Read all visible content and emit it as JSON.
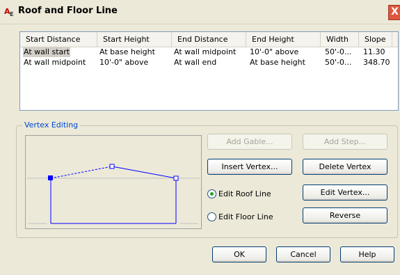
{
  "window": {
    "title": "Roof and Floor Line",
    "icon_text": "A",
    "icon_subtext": "E",
    "close_label": "X"
  },
  "columns": [
    "Start Distance",
    "Start Height",
    "End Distance",
    "End Height",
    "Width",
    "Slope"
  ],
  "rows": [
    [
      "At wall start",
      "At base height",
      "At wall midpoint",
      "10'-0\" above",
      "50'-0...",
      "11.30"
    ],
    [
      "At wall midpoint",
      "10'-0\" above",
      "At wall end",
      "At base height",
      "50'-0...",
      "348.70"
    ]
  ],
  "vertex_editing": {
    "label": "Vertex Editing",
    "buttons": {
      "add_gable": "Add Gable...",
      "add_step": "Add Step...",
      "insert_vertex": "Insert Vertex...",
      "delete_vertex": "Delete Vertex",
      "edit_vertex": "Edit Vertex...",
      "reverse": "Reverse"
    },
    "radios": {
      "edit_roof_line": "Edit Roof Line",
      "edit_floor_line": "Edit Floor Line",
      "selected": "edit_roof_line"
    }
  },
  "footer": {
    "ok": "OK",
    "cancel": "Cancel",
    "help": "Help"
  },
  "colors": {
    "accent_blue": "#0000ff",
    "group_label": "#0046d5",
    "radio_dot": "#21a121"
  }
}
